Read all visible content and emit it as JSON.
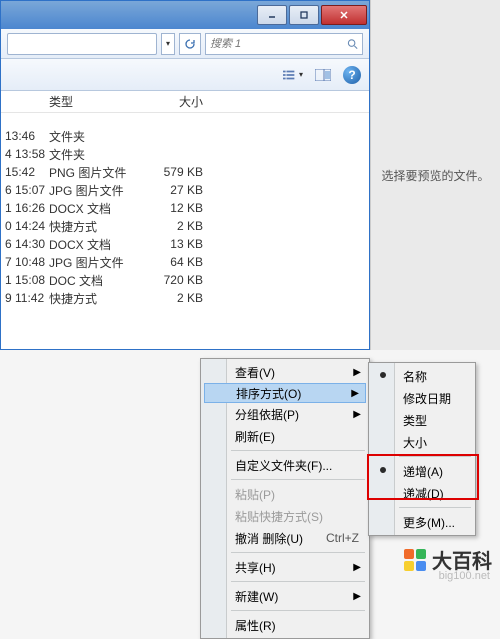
{
  "window": {
    "search_placeholder": "搜索 1",
    "addr_dropdown": "▾",
    "columns": {
      "type": "类型",
      "size": "大小"
    },
    "preview_hint": "选择要预览的文件。"
  },
  "files": [
    {
      "time": "13:46",
      "type": "文件夹",
      "size": ""
    },
    {
      "time": "4 13:58",
      "type": "文件夹",
      "size": ""
    },
    {
      "time": "15:42",
      "type": "PNG 图片文件",
      "size": "579 KB"
    },
    {
      "time": "6 15:07",
      "type": "JPG 图片文件",
      "size": "27 KB"
    },
    {
      "time": "1 16:26",
      "type": "DOCX 文档",
      "size": "12 KB"
    },
    {
      "time": "0 14:24",
      "type": "快捷方式",
      "size": "2 KB"
    },
    {
      "time": "6 14:30",
      "type": "DOCX 文档",
      "size": "13 KB"
    },
    {
      "time": "7 10:48",
      "type": "JPG 图片文件",
      "size": "64 KB"
    },
    {
      "time": "1 15:08",
      "type": "DOC 文档",
      "size": "720 KB"
    },
    {
      "time": "9 11:42",
      "type": "快捷方式",
      "size": "2 KB"
    }
  ],
  "menu": {
    "view": "查看(V)",
    "sort": "排序方式(O)",
    "group": "分组依据(P)",
    "refresh": "刷新(E)",
    "customize": "自定义文件夹(F)...",
    "paste": "粘贴(P)",
    "paste_shortcut": "粘贴快捷方式(S)",
    "undo": "撤消 删除(U)",
    "undo_key": "Ctrl+Z",
    "share": "共享(H)",
    "new": "新建(W)",
    "properties": "属性(R)"
  },
  "sortmenu": {
    "name": "名称",
    "date": "修改日期",
    "type": "类型",
    "size": "大小",
    "asc": "递增(A)",
    "desc": "递减(D)",
    "more": "更多(M)..."
  },
  "watermark": {
    "text": "大百科",
    "url": "big100.net"
  },
  "logo_colors": [
    "#f06b2a",
    "#35b558",
    "#f7cf2f",
    "#4a8df0"
  ]
}
